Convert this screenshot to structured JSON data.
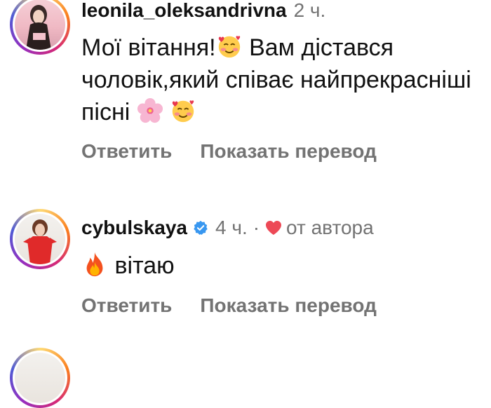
{
  "comments": [
    {
      "username": "leonila_oleksandrivna",
      "time": "2 ч.",
      "text_parts": [
        "Мої вітання!",
        "Вам дістався чоловік,який співає найпрекрасніші пісні"
      ],
      "emojis": [
        "smiling-hearts-emoji",
        "cherry-blossom-emoji",
        "smiling-hearts-emoji"
      ],
      "reply_label": "Ответить",
      "translate_label": "Показать перевод"
    },
    {
      "username": "cybulskaya",
      "verified": true,
      "time": "4 ч.",
      "separator": "·",
      "liked_by_author_label": "от автора",
      "text": "вітаю",
      "emojis": [
        "fire-emoji"
      ],
      "reply_label": "Ответить",
      "translate_label": "Показать перевод"
    }
  ],
  "colors": {
    "text": "#111111",
    "muted": "#737373",
    "verified": "#3897f0",
    "heart": "#ed4956"
  }
}
